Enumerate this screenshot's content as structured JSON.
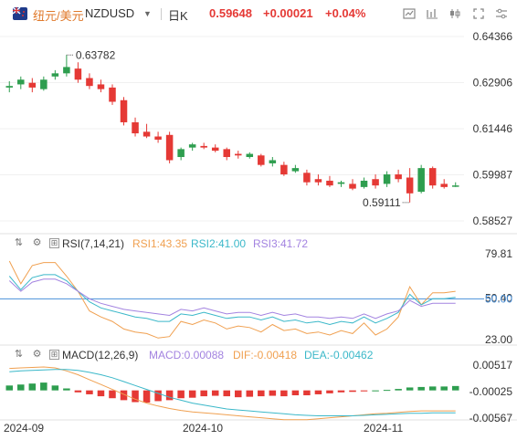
{
  "header": {
    "pair_cn": "纽元/美元",
    "pair_en": "NZDUSD",
    "timeframe": "日K",
    "price": "0.59648",
    "change": "+0.00021",
    "change_pct": "+0.04%",
    "icons": [
      "chart-type-icon",
      "indicator-icon",
      "candle-style-icon",
      "expand-icon",
      "settings-icon"
    ]
  },
  "colors": {
    "up": "#e53935",
    "down": "#2e9e4f",
    "accent": "#e07a2c",
    "rsi1": "#f0a050",
    "rsi2": "#3bb8c9",
    "rsi3": "#a383e0",
    "dif": "#f0a050",
    "dea": "#3bb8c9"
  },
  "price_axis": [
    "0.64366",
    "0.62906",
    "0.61446",
    "0.59987",
    "0.58527"
  ],
  "annotations": {
    "high": "0.63782",
    "low": "0.59111"
  },
  "rsi": {
    "label": "RSI(7,14,21)",
    "rsi1": "RSI1:43.35",
    "rsi2": "RSI2:41.00",
    "rsi3": "RSI3:41.72",
    "axis": [
      "79.81",
      "50.40",
      "23.00"
    ],
    "line_label": "50.00"
  },
  "macd": {
    "label": "MACD(12,26,9)",
    "macd": "MACD:0.00088",
    "dif": "DIF:-0.00418",
    "dea": "DEA:-0.00462",
    "axis": [
      "0.00517",
      "-0.00025",
      "-0.00567"
    ]
  },
  "time_axis": [
    "2024-09",
    "2024-10",
    "2024-11"
  ],
  "chart_data": {
    "type": "candlestick",
    "title": "纽元/美元 NZDUSD 日K",
    "ylim": [
      0.58527,
      0.64366
    ],
    "candles": [
      [
        0.6275,
        0.6295,
        0.628,
        0.626
      ],
      [
        0.6285,
        0.631,
        0.63,
        0.627
      ],
      [
        0.629,
        0.6305,
        0.6275,
        0.626
      ],
      [
        0.627,
        0.631,
        0.63,
        0.6265
      ],
      [
        0.631,
        0.633,
        0.632,
        0.63
      ],
      [
        0.632,
        0.6378,
        0.634,
        0.631
      ],
      [
        0.6335,
        0.6355,
        0.63,
        0.629
      ],
      [
        0.6305,
        0.632,
        0.628,
        0.627
      ],
      [
        0.6285,
        0.63,
        0.627,
        0.626
      ],
      [
        0.6275,
        0.6285,
        0.623,
        0.622
      ],
      [
        0.6235,
        0.6245,
        0.6165,
        0.6155
      ],
      [
        0.6165,
        0.618,
        0.613,
        0.612
      ],
      [
        0.6135,
        0.616,
        0.612,
        0.6115
      ],
      [
        0.612,
        0.6135,
        0.611,
        0.61
      ],
      [
        0.6125,
        0.6135,
        0.6045,
        0.6035
      ],
      [
        0.6055,
        0.6085,
        0.608,
        0.6045
      ],
      [
        0.6085,
        0.61,
        0.6095,
        0.6075
      ],
      [
        0.609,
        0.61,
        0.6085,
        0.608
      ],
      [
        0.6085,
        0.6095,
        0.6075,
        0.607
      ],
      [
        0.608,
        0.6085,
        0.6055,
        0.6045
      ],
      [
        0.6065,
        0.6075,
        0.606,
        0.605
      ],
      [
        0.6055,
        0.607,
        0.6065,
        0.605
      ],
      [
        0.606,
        0.6065,
        0.603,
        0.6025
      ],
      [
        0.6035,
        0.6055,
        0.6045,
        0.6025
      ],
      [
        0.603,
        0.604,
        0.6,
        0.5995
      ],
      [
        0.601,
        0.603,
        0.602,
        0.6005
      ],
      [
        0.6005,
        0.6015,
        0.5975,
        0.5965
      ],
      [
        0.5985,
        0.6,
        0.5975,
        0.5965
      ],
      [
        0.598,
        0.5995,
        0.5965,
        0.596
      ],
      [
        0.597,
        0.598,
        0.5975,
        0.596
      ],
      [
        0.597,
        0.5985,
        0.5955,
        0.595
      ],
      [
        0.596,
        0.599,
        0.598,
        0.5955
      ],
      [
        0.5985,
        0.6,
        0.5965,
        0.5955
      ],
      [
        0.597,
        0.601,
        0.6,
        0.596
      ],
      [
        0.6,
        0.6015,
        0.5985,
        0.5975
      ],
      [
        0.599,
        0.602,
        0.594,
        0.5911
      ],
      [
        0.5945,
        0.603,
        0.602,
        0.594
      ],
      [
        0.602,
        0.6025,
        0.5965,
        0.5955
      ],
      [
        0.597,
        0.5985,
        0.596,
        0.5955
      ],
      [
        0.5962,
        0.5975,
        0.5965,
        0.596
      ]
    ],
    "rsi1": [
      75,
      60,
      72,
      74,
      74,
      65,
      55,
      42,
      38,
      35,
      30,
      28,
      27,
      24,
      25,
      35,
      33,
      36,
      34,
      30,
      32,
      31,
      28,
      33,
      29,
      30,
      27,
      28,
      26,
      29,
      27,
      34,
      26,
      30,
      38,
      58,
      46,
      54,
      54,
      55
    ],
    "rsi2": [
      65,
      56,
      64,
      66,
      66,
      62,
      55,
      48,
      44,
      42,
      40,
      38,
      37,
      35,
      35,
      40,
      39,
      41,
      39,
      37,
      38,
      38,
      36,
      38,
      35,
      36,
      34,
      35,
      33,
      35,
      34,
      38,
      34,
      37,
      41,
      53,
      46,
      50,
      50,
      51
    ],
    "rsi3": [
      62,
      55,
      61,
      63,
      63,
      60,
      55,
      50,
      47,
      45,
      43,
      42,
      41,
      40,
      39,
      43,
      42,
      44,
      42,
      40,
      41,
      41,
      39,
      41,
      39,
      40,
      38,
      38,
      37,
      38,
      37,
      40,
      37,
      40,
      42,
      49,
      45,
      47,
      47,
      47
    ],
    "macd_hist": [
      0.001,
      0.0012,
      0.0014,
      0.0016,
      0.001,
      0.0004,
      -0.0004,
      -0.0008,
      -0.0012,
      -0.0016,
      -0.002,
      -0.0024,
      -0.0025,
      -0.0022,
      -0.002,
      -0.0016,
      -0.0015,
      -0.0012,
      -0.0011,
      -0.0012,
      -0.0014,
      -0.0013,
      -0.0012,
      -0.0011,
      -0.0012,
      -0.001,
      -0.001,
      -0.0008,
      -0.0006,
      -0.0004,
      -0.0003,
      -0.0002,
      0.0,
      0.0001,
      0.0003,
      0.0006,
      0.0007,
      0.0008,
      0.0008,
      0.0009
    ],
    "dif": [
      0.0045,
      0.0046,
      0.0047,
      0.0048,
      0.0046,
      0.004,
      0.0032,
      0.0022,
      0.0012,
      0.0002,
      -0.0008,
      -0.0018,
      -0.0026,
      -0.0032,
      -0.0037,
      -0.0041,
      -0.0044,
      -0.0046,
      -0.0048,
      -0.005,
      -0.0052,
      -0.0054,
      -0.0056,
      -0.0058,
      -0.006,
      -0.006,
      -0.006,
      -0.0058,
      -0.0056,
      -0.0054,
      -0.0052,
      -0.005,
      -0.0048,
      -0.0047,
      -0.0045,
      -0.0043,
      -0.0042,
      -0.0042,
      -0.0042,
      -0.0042
    ],
    "dea": [
      0.0038,
      0.004,
      0.0041,
      0.0042,
      0.0043,
      0.0043,
      0.0041,
      0.0037,
      0.0032,
      0.0026,
      0.0018,
      0.001,
      0.0002,
      -0.0006,
      -0.0014,
      -0.002,
      -0.0026,
      -0.003,
      -0.0034,
      -0.0038,
      -0.004,
      -0.0042,
      -0.0044,
      -0.0046,
      -0.0048,
      -0.005,
      -0.0051,
      -0.0052,
      -0.0052,
      -0.0052,
      -0.0052,
      -0.0051,
      -0.005,
      -0.0049,
      -0.0048,
      -0.0047,
      -0.0047,
      -0.0046,
      -0.0046,
      -0.0046
    ],
    "rsi_ylim": [
      23.0,
      79.81
    ],
    "macd_ylim": [
      -0.00567,
      0.00517
    ]
  }
}
